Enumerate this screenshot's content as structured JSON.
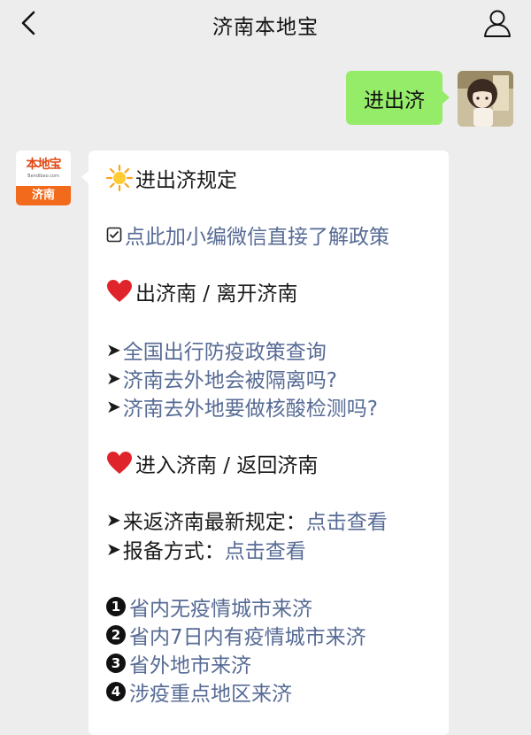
{
  "header": {
    "title": "济南本地宝"
  },
  "user_message": {
    "text": "进出济"
  },
  "bot": {
    "logo_text": "本地宝",
    "logo_url": "Bendibao.com",
    "logo_city": "济南"
  },
  "reply": {
    "section_title": "进出济规定",
    "wechat_link": "点此加小编微信直接了解政策",
    "leave_heading": "出济南 / 离开济南",
    "leave_links": [
      "全国出行防疫政策查询",
      "济南去外地会被隔离吗?",
      "济南去外地要做核酸检测吗?"
    ],
    "enter_heading": "进入济南 / 返回济南",
    "enter_items": [
      {
        "label": "来返济南最新规定：",
        "link": "点击查看"
      },
      {
        "label": "报备方式：",
        "link": "点击查看"
      }
    ],
    "numbered_links": [
      {
        "num": "1",
        "text": "省内无疫情城市来济"
      },
      {
        "num": "2",
        "text": "省内7日内有疫情城市来济"
      },
      {
        "num": "3",
        "text": "省外地市来济"
      },
      {
        "num": "4",
        "text": "涉疫重点地区来济"
      }
    ]
  }
}
